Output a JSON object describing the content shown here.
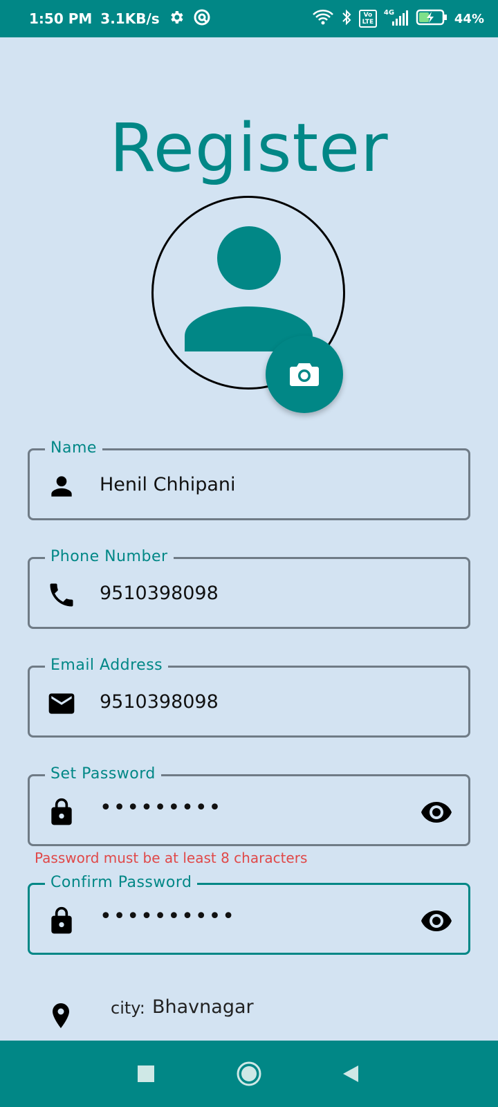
{
  "status_bar": {
    "time": "1:50 PM",
    "speed": "3.1KB/s",
    "network": "4G",
    "volte": "Vo LTE",
    "battery_pct": "44%"
  },
  "title": "Register",
  "icons": {
    "settings": "gear-icon",
    "camera": "camera-icon",
    "person": "person-icon",
    "phone": "phone-icon",
    "email": "mail-icon",
    "lock": "lock-icon",
    "eye": "eye-icon",
    "location": "location-pin-icon"
  },
  "fields": {
    "name": {
      "label": "Name",
      "value": "Henil Chhipani"
    },
    "phone": {
      "label": "Phone Number",
      "value": "9510398098"
    },
    "email": {
      "label": "Email Address",
      "value": "9510398098"
    },
    "password": {
      "label": "Set Password",
      "value": "•••••••••"
    },
    "confirm_password": {
      "label": "Confirm Password",
      "value": "••••••••••"
    }
  },
  "password_error": "Password must be at least 8 characters",
  "city": {
    "label": "city:",
    "value": "Bhavnagar"
  },
  "colors": {
    "accent": "#018786",
    "background": "#d3e3f2",
    "error": "#e04848"
  }
}
